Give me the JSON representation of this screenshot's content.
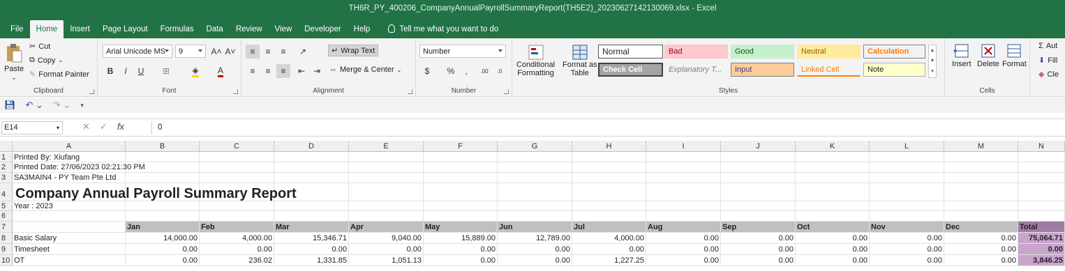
{
  "window": {
    "title": "TH6R_PY_400206_CompanyAnnualPayrollSummaryReport(TH5E2)_20230627142130069.xlsx  -  Excel"
  },
  "tabs": [
    "File",
    "Home",
    "Insert",
    "Page Layout",
    "Formulas",
    "Data",
    "Review",
    "View",
    "Developer",
    "Help"
  ],
  "tell_me": "Tell me what you want to do",
  "ribbon": {
    "clipboard": {
      "paste": "Paste",
      "cut": "Cut",
      "copy": "Copy",
      "format_painter": "Format Painter",
      "label": "Clipboard"
    },
    "font": {
      "name": "Arial Unicode MS",
      "size": "9",
      "label": "Font"
    },
    "alignment": {
      "wrap_text": "Wrap Text",
      "merge_center": "Merge & Center",
      "label": "Alignment"
    },
    "number": {
      "format": "Number",
      "label": "Number"
    },
    "styles": {
      "conditional": "Conditional",
      "conditional2": "Formatting",
      "format_as": "Format as",
      "format_as2": "Table",
      "cells": [
        "Normal",
        "Bad",
        "Good",
        "Neutral",
        "Calculation",
        "Check Cell",
        "Explanatory T...",
        "Input",
        "Linked Cell",
        "Note"
      ],
      "label": "Styles"
    },
    "cells": {
      "insert": "Insert",
      "delete": "Delete",
      "format": "Format",
      "label": "Cells"
    },
    "editing": {
      "autosum": "Aut",
      "fill": "Fill",
      "clear": "Cle"
    }
  },
  "formula_bar": {
    "name_box": "E14",
    "formula": "0"
  },
  "columns": [
    "A",
    "B",
    "C",
    "D",
    "E",
    "F",
    "G",
    "H",
    "I",
    "J",
    "K",
    "L",
    "M",
    "N"
  ],
  "rows": [
    "1",
    "2",
    "3",
    "4",
    "5",
    "6",
    "7",
    "8",
    "9",
    "10"
  ],
  "sheet": {
    "printed_by": "Printed By: Xiufang",
    "printed_date": "Printed Date: 27/06/2023 02:21:30 PM",
    "company": "SA3MAIN4 - PY Team Pte Ltd",
    "report_title": "Company Annual Payroll Summary Report",
    "year": "Year : 2023",
    "months": [
      "Jan",
      "Feb",
      "Mar",
      "Apr",
      "May",
      "Jun",
      "Jul",
      "Aug",
      "Sep",
      "Oct",
      "Nov",
      "Dec"
    ],
    "total_label": "Total",
    "data_rows": [
      {
        "label": "Basic Salary",
        "values": [
          "14,000.00",
          "4,000.00",
          "15,346.71",
          "9,040.00",
          "15,889.00",
          "12,789.00",
          "4,000.00",
          "0.00",
          "0.00",
          "0.00",
          "0.00",
          "0.00"
        ],
        "total": "75,064.71"
      },
      {
        "label": "Timesheet",
        "values": [
          "0.00",
          "0.00",
          "0.00",
          "0.00",
          "0.00",
          "0.00",
          "0.00",
          "0.00",
          "0.00",
          "0.00",
          "0.00",
          "0.00"
        ],
        "total": "0.00"
      },
      {
        "label": "OT",
        "values": [
          "0.00",
          "236.02",
          "1,331.85",
          "1,051.13",
          "0.00",
          "0.00",
          "1,227.25",
          "0.00",
          "0.00",
          "0.00",
          "0.00",
          "0.00"
        ],
        "total": "3,846.25"
      }
    ]
  }
}
